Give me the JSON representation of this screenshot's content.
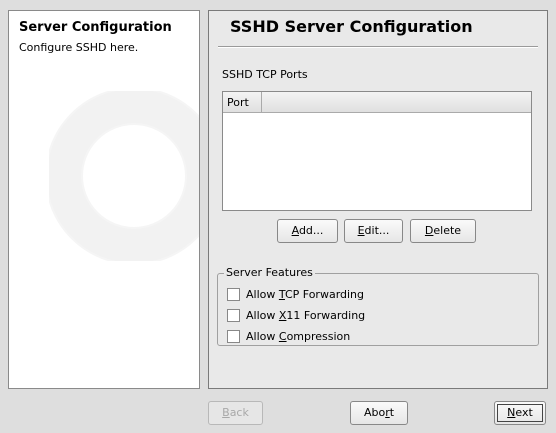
{
  "help": {
    "title": "Server Configuration",
    "text": "Configure SSHD here."
  },
  "main": {
    "title": "SSHD Server Configuration",
    "ports_label": "SSHD TCP Ports",
    "table": {
      "columns": [
        "Port",
        ""
      ],
      "rows": []
    },
    "buttons": {
      "add": {
        "mnemonic": "A",
        "rest": "dd..."
      },
      "edit": {
        "mnemonic": "E",
        "rest": "dit..."
      },
      "delete": {
        "mnemonic": "D",
        "rest": "elete"
      }
    },
    "features": {
      "legend": "Server Features",
      "options": [
        {
          "pre": "Allow ",
          "mnemonic": "T",
          "post": "CP Forwarding",
          "checked": false
        },
        {
          "pre": "Allow ",
          "mnemonic": "X",
          "post": "11 Forwarding",
          "checked": false
        },
        {
          "pre": "Allow ",
          "mnemonic": "C",
          "post": "ompression",
          "checked": false
        }
      ]
    }
  },
  "footer": {
    "back": {
      "mnemonic": "B",
      "rest": "ack",
      "enabled": false
    },
    "abort": {
      "pre": "Abo",
      "mnemonic": "r",
      "post": "t"
    },
    "next": {
      "mnemonic": "N",
      "rest": "ext"
    }
  }
}
